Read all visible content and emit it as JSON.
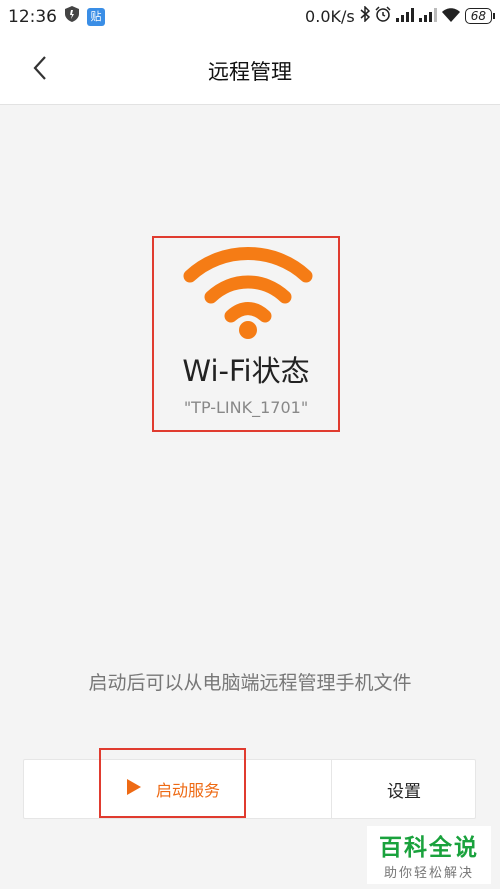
{
  "status_bar": {
    "time": "12:36",
    "app_badge": "贴",
    "network_speed": "0.0K/s",
    "battery": "68",
    "icons": [
      "shield-icon",
      "app-badge-icon",
      "bluetooth-icon",
      "alarm-icon",
      "signal-icon",
      "signal-icon",
      "wifi-icon",
      "battery-icon"
    ]
  },
  "header": {
    "title": "远程管理",
    "back_icon": "chevron-left-icon"
  },
  "wifi": {
    "title": "Wi-Fi状态",
    "ssid": "\"TP-LINK_1701\"",
    "icon": "wifi-icon",
    "accent_color": "#f57c15"
  },
  "hint": "启动后可以从电脑端远程管理手机文件",
  "actions": {
    "start_label": "启动服务",
    "start_icon": "play-icon",
    "settings_label": "设置",
    "accent_color": "#ee6a14"
  },
  "watermark": {
    "title": "百科全说",
    "subtitle": "助你轻松解决"
  },
  "highlight_color": "#e03b2f"
}
